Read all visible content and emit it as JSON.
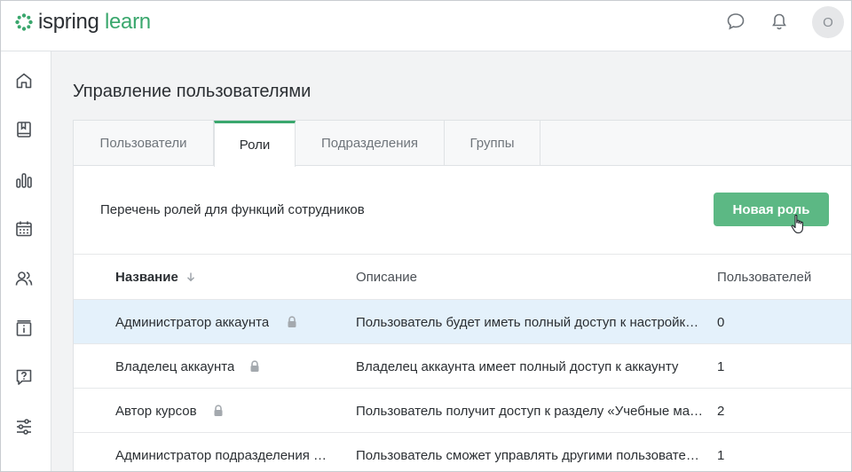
{
  "app": {
    "logo_text_part1": "ispring",
    "logo_text_part2": " learn",
    "brand_color": "#3aa76d",
    "avatar_letter": "O"
  },
  "header_icons": [
    "chat-icon",
    "bell-icon"
  ],
  "sidebar": {
    "items": [
      {
        "icon": "home-icon"
      },
      {
        "icon": "book-icon"
      },
      {
        "icon": "bar-chart-icon"
      },
      {
        "icon": "calendar-icon"
      },
      {
        "icon": "users-icon",
        "active": true
      },
      {
        "icon": "info-board-icon"
      },
      {
        "icon": "help-icon"
      },
      {
        "icon": "settings-sliders-icon"
      }
    ]
  },
  "page": {
    "title": "Управление пользователями",
    "tabs": [
      {
        "label": "Пользователи"
      },
      {
        "label": "Роли",
        "active": true
      },
      {
        "label": "Подразделения"
      },
      {
        "label": "Группы"
      }
    ],
    "subtitle": "Перечень ролей для функций сотрудников",
    "new_role_button": "Новая роль"
  },
  "table": {
    "columns": [
      "Название",
      "Описание",
      "Пользователей"
    ],
    "rows": [
      {
        "name": "Администратор аккаунта",
        "locked": true,
        "description": "Пользователь будет иметь полный доступ к настройк…",
        "users": "0",
        "selected": true
      },
      {
        "name": "Владелец аккаунта",
        "locked": true,
        "description": "Владелец аккаунта имеет полный доступ к аккаунту",
        "users": "1"
      },
      {
        "name": "Автор курсов",
        "locked": true,
        "description": "Пользователь получит доступ к разделу «Учебные ма…",
        "users": "2"
      },
      {
        "name": "Администратор подразделения …",
        "locked": false,
        "description": "Пользователь сможет управлять другими пользовате…",
        "users": "1"
      }
    ]
  }
}
